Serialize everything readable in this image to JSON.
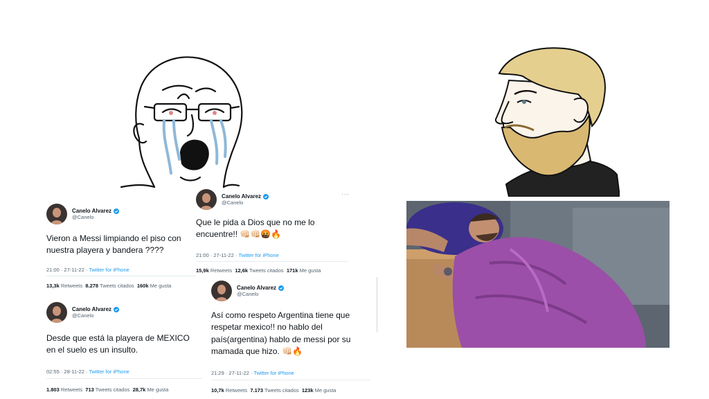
{
  "tweets": [
    {
      "name": "Canelo Alvarez",
      "handle": "@Canelo",
      "text": "Vieron a Messi limpiando el piso con\nnuestra playera y bandera ????",
      "time": "21:00 · 27-11-22 ·",
      "source": "Twitter for iPhone",
      "retweets": "13,3k",
      "retweets_label": "Retweets",
      "quotes": "8.278",
      "quotes_label": "Tweets citados",
      "likes": "160k",
      "likes_label": "Me gusta"
    },
    {
      "name": "Canelo Alvarez",
      "handle": "@Canelo",
      "text": "Que le pida a Dios que no me lo\nencuentre!! 👊🏻👊🏻🤬🔥",
      "time": "21:00 · 27-11-22 ·",
      "source": "Twitter for iPhone",
      "retweets": "15,9k",
      "retweets_label": "Retweets",
      "quotes": "12,6k",
      "quotes_label": "Tweets citados",
      "likes": "171k",
      "likes_label": "Me gusta"
    },
    {
      "name": "Canelo Alvarez",
      "handle": "@Canelo",
      "text": "Desde que está la playera de MEXICO\nen el suelo es un insulto.",
      "time": "02:55 · 28-11-22 ·",
      "source": "Twitter for iPhone",
      "retweets": "1.803",
      "retweets_label": "Retweets",
      "quotes": "713",
      "quotes_label": "Tweets citados",
      "likes": "28,7k",
      "likes_label": "Me gusta"
    },
    {
      "name": "Canelo Alvarez",
      "handle": "@Canelo",
      "text": "Así como respeto Argentina tiene que\nrespetar mexico!! no hablo del\npaís(argentina) hablo de messi por su\nmamada que hizo. 👊🏻🔥",
      "time": "21:29 · 27-11-22 ·",
      "source": "Twitter for iPhone",
      "retweets": "10,7k",
      "retweets_label": "Retweets",
      "quotes": "7.173",
      "quotes_label": "Tweets citados",
      "likes": "123k",
      "likes_label": "Me gusta"
    }
  ],
  "colors": {
    "twitter_blue": "#1d9bf0",
    "secondary_text": "#536471",
    "wojak_tears": "#8fb8d8",
    "chad_hair": "#e5cf8f",
    "blanket_purple": "#9b4fa8"
  },
  "icons": [
    "verified-badge-icon",
    "more-options-icon"
  ]
}
